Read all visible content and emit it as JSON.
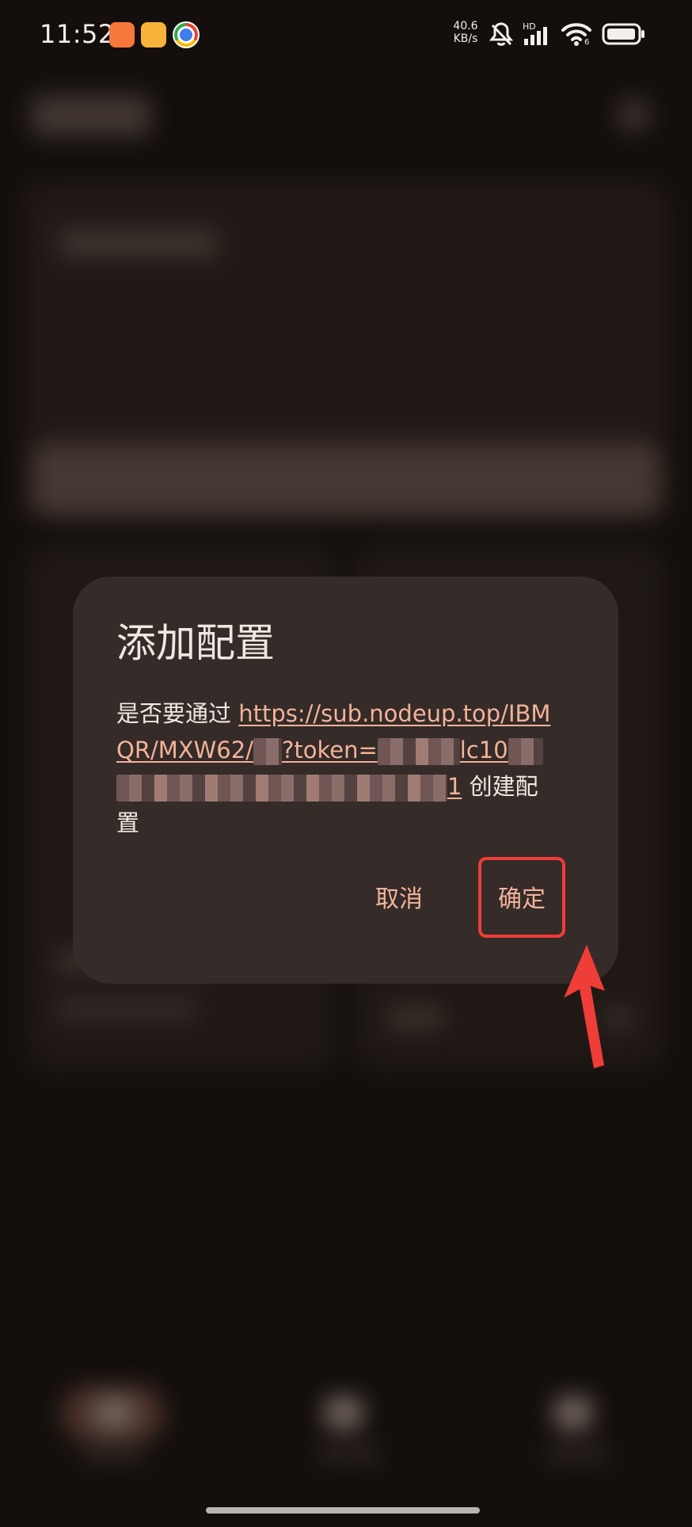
{
  "status_bar": {
    "time": "11:52",
    "network_speed_value": "40.6",
    "network_speed_unit": "KB/s",
    "hd_label": "HD",
    "wifi_sub": "6",
    "app_icons": [
      "orange-app-icon",
      "yellow-app-icon",
      "chrome-icon"
    ],
    "icons": [
      "mute-icon",
      "signal-icon",
      "wifi-icon",
      "battery-icon"
    ]
  },
  "dialog": {
    "title": "添加配置",
    "message_prefix": "是否要通过 ",
    "link_part_1": "https://sub.nodeup.top/",
    "link_part_2": "IBMQR/MXW62/",
    "link_part_3": "?token=",
    "link_part_4": "lc10",
    "link_part_5": "1",
    "message_suffix": " 创建配置",
    "cancel_label": "取消",
    "confirm_label": "确定"
  },
  "colors": {
    "background": "#140f0d",
    "dialog": "#352b28",
    "accent": "#f2b49b",
    "annotation": "#ef3d38"
  }
}
